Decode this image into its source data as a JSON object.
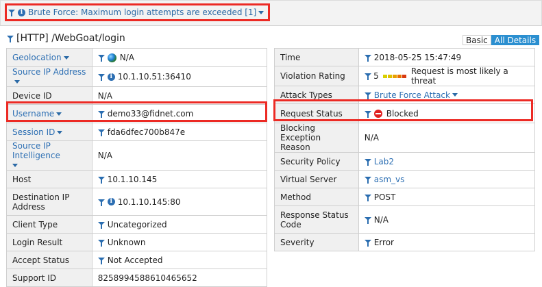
{
  "header": {
    "violation_filter": "Brute Force: Maximum login attempts are exceeded [1]"
  },
  "request": {
    "title": "[HTTP] /WebGoat/login"
  },
  "view_toggle": {
    "basic": "Basic",
    "all": "All Details"
  },
  "left_rows": [
    {
      "label": "Geolocation",
      "value": "N/A"
    },
    {
      "label": "Source IP Address",
      "value": "10.1.10.51:36410"
    },
    {
      "label": "Device ID",
      "value": "N/A"
    },
    {
      "label": "Username",
      "value": "demo33@fidnet.com"
    },
    {
      "label": "Session ID",
      "value": "fda6dfec700b847e"
    },
    {
      "label": "Source IP Intelligence",
      "value": "N/A"
    },
    {
      "label": "Host",
      "value": "10.1.10.145"
    },
    {
      "label": "Destination IP Address",
      "value": "10.1.10.145:80"
    },
    {
      "label": "Client Type",
      "value": "Uncategorized"
    },
    {
      "label": "Login Result",
      "value": "Unknown"
    },
    {
      "label": "Accept Status",
      "value": "Not Accepted"
    },
    {
      "label": "Support ID",
      "value": "8258994588610465652"
    }
  ],
  "right_rows": [
    {
      "label": "Time",
      "value": "2018-05-25 15:47:49"
    },
    {
      "label": "Violation Rating",
      "value": "5",
      "extra": "Request is most likely a threat"
    },
    {
      "label": "Attack Types",
      "value": "Brute Force Attack"
    },
    {
      "label": "Request Status",
      "value": "Blocked"
    },
    {
      "label": "Blocking Exception Reason",
      "value": "N/A"
    },
    {
      "label": "Security Policy",
      "value": "Lab2"
    },
    {
      "label": "Virtual Server",
      "value": "asm_vs"
    },
    {
      "label": "Method",
      "value": "POST"
    },
    {
      "label": "Response Status Code",
      "value": "N/A"
    },
    {
      "label": "Severity",
      "value": "Error"
    }
  ],
  "colors": {
    "highlight": "#ec2a24",
    "link": "#2d6fb3",
    "accent": "#2b8fd0"
  }
}
